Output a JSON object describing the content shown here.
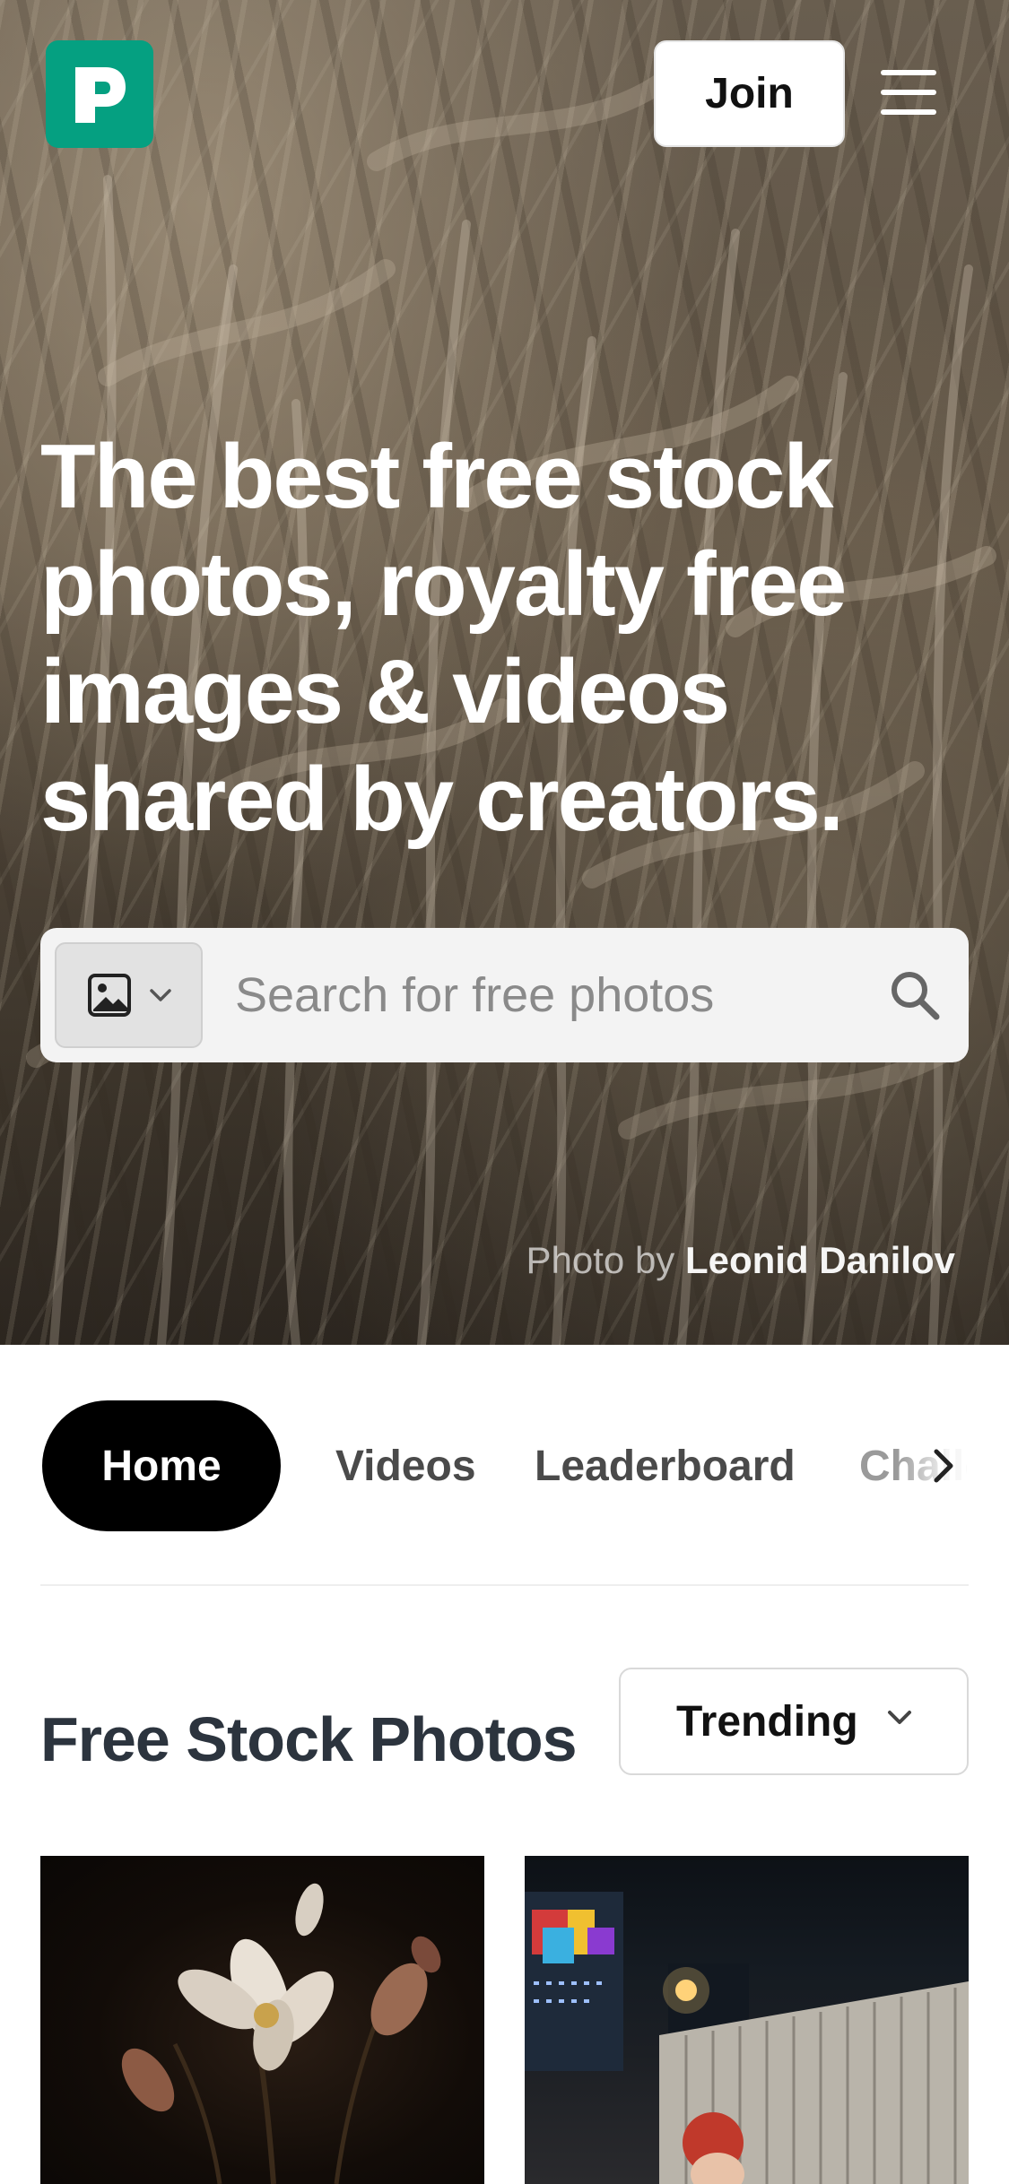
{
  "header": {
    "logo_letter": "P",
    "join_label": "Join",
    "menu_icon": "hamburger-menu-icon"
  },
  "hero": {
    "title": "The best free stock photos, royalty free images & videos shared by creators.",
    "search": {
      "media_type_icon": "image-icon",
      "placeholder": "Search for free photos",
      "search_icon": "search-icon"
    },
    "credit": {
      "prefix": "Photo by ",
      "author": "Leonid Danilov"
    }
  },
  "nav": {
    "tabs": [
      {
        "label": "Home",
        "active": true
      },
      {
        "label": "Videos",
        "active": false
      },
      {
        "label": "Leaderboard",
        "active": false
      },
      {
        "label": "Challenges",
        "active": false
      }
    ]
  },
  "section": {
    "title": "Free Stock Photos",
    "sort_selected": "Trending"
  },
  "colors": {
    "brand": "#05a081",
    "active_tab_bg": "#000000",
    "section_title": "#2c343e"
  }
}
